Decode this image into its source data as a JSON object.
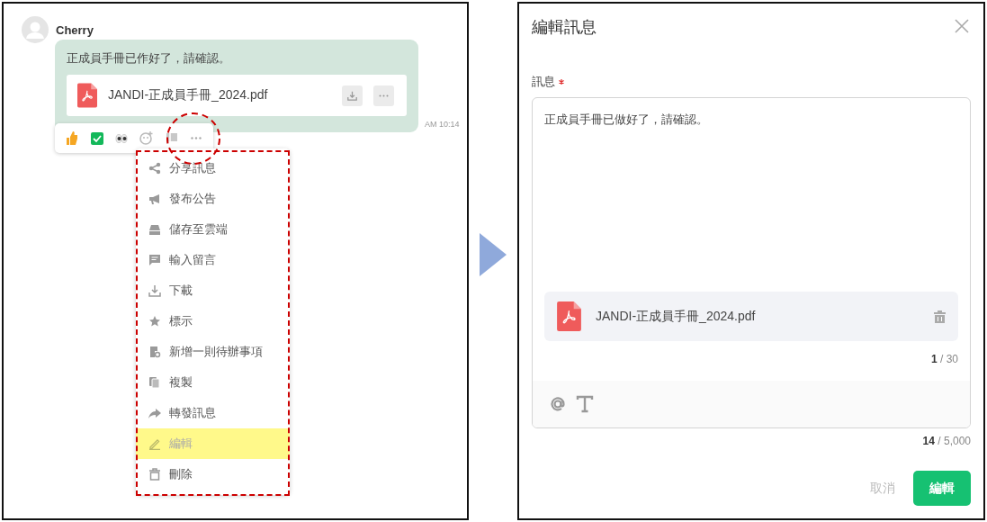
{
  "chat": {
    "sender": "Cherry",
    "message": "正成員手冊已作好了，請確認。",
    "attachment": "JANDI-正成員手冊_2024.pdf",
    "time": "AM 10:14",
    "menu": [
      {
        "label": "分享訊息",
        "selected": false
      },
      {
        "label": "發布公告",
        "selected": false
      },
      {
        "label": "儲存至雲端",
        "selected": false
      },
      {
        "label": "輸入留言",
        "selected": false
      },
      {
        "label": "下載",
        "selected": false
      },
      {
        "label": "標示",
        "selected": false
      },
      {
        "label": "新增一則待辦事項",
        "selected": false
      },
      {
        "label": "複製",
        "selected": false
      },
      {
        "label": "轉發訊息",
        "selected": false
      },
      {
        "label": "編輯",
        "selected": true
      },
      {
        "label": "刪除",
        "selected": false
      }
    ]
  },
  "dialog": {
    "title": "編輯訊息",
    "field_label": "訊息",
    "required": true,
    "value": "正成員手冊已做好了，請確認。",
    "attachment": "JANDI-正成員手冊_2024.pdf",
    "file_count": "**1** / 30",
    "char_count": "**14** / 5,000",
    "buttons": [
      {
        "label": "取消",
        "kind": "secondary"
      },
      {
        "label": "編輯",
        "kind": "primary"
      }
    ]
  }
}
